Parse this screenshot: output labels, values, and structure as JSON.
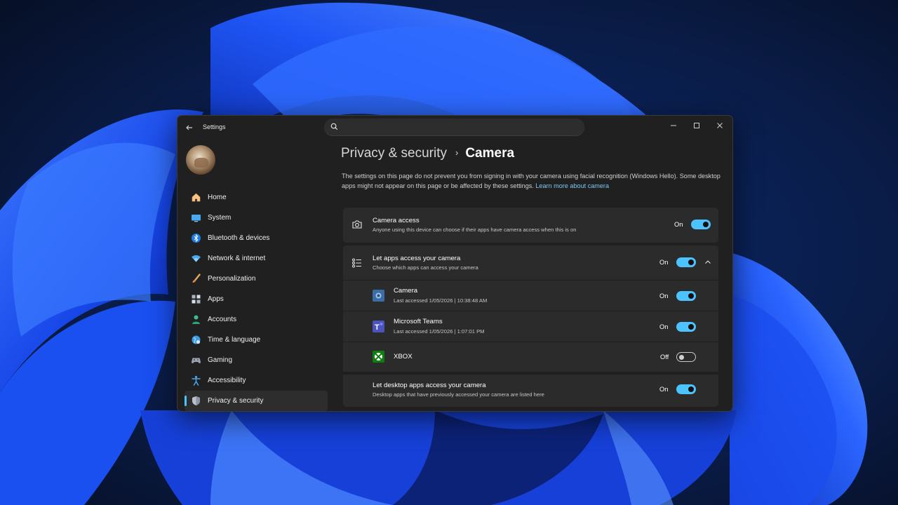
{
  "window": {
    "app_title": "Settings",
    "search_placeholder": ""
  },
  "sidebar": {
    "items": [
      {
        "label": "Home",
        "icon": "home-icon"
      },
      {
        "label": "System",
        "icon": "system-icon"
      },
      {
        "label": "Bluetooth & devices",
        "icon": "bluetooth-icon"
      },
      {
        "label": "Network & internet",
        "icon": "wifi-icon"
      },
      {
        "label": "Personalization",
        "icon": "brush-icon"
      },
      {
        "label": "Apps",
        "icon": "apps-icon"
      },
      {
        "label": "Accounts",
        "icon": "person-icon"
      },
      {
        "label": "Time & language",
        "icon": "globe-icon"
      },
      {
        "label": "Gaming",
        "icon": "gamepad-icon"
      },
      {
        "label": "Accessibility",
        "icon": "accessibility-icon"
      },
      {
        "label": "Privacy & security",
        "icon": "shield-icon",
        "active": true
      }
    ]
  },
  "header": {
    "parent": "Privacy & security",
    "separator": "›",
    "current": "Camera"
  },
  "description": {
    "text": "The settings on this page do not prevent you from signing in with your camera using facial recognition (Windows Hello). Some desktop apps might not appear on this page or be affected by these settings.",
    "link": "Learn more about camera"
  },
  "camera_access": {
    "title": "Camera access",
    "subtitle": "Anyone using this device can choose if their apps have camera access when this is on",
    "state": "On",
    "enabled": true
  },
  "let_apps": {
    "title": "Let apps access your camera",
    "subtitle": "Choose which apps can access your camera",
    "state": "On",
    "enabled": true,
    "expanded": true
  },
  "apps": [
    {
      "name": "Camera",
      "detail": "Last accessed 1/05/2026  |  10:38:48 AM",
      "state": "On",
      "enabled": true,
      "icon": "camera-app-icon"
    },
    {
      "name": "Microsoft Teams",
      "detail": "Last accessed 1/05/2026  |  1:07:01 PM",
      "state": "On",
      "enabled": true,
      "icon": "teams-icon"
    },
    {
      "name": "XBOX",
      "detail": "",
      "state": "Off",
      "enabled": false,
      "icon": "xbox-icon"
    }
  ],
  "desktop_apps": {
    "title": "Let desktop apps access your camera",
    "subtitle": "Desktop apps that have previously accessed your camera are listed here",
    "state": "On",
    "enabled": true
  },
  "colors": {
    "accent": "#4cc2ff",
    "window_bg": "#202020",
    "card_bg": "#2b2b2b",
    "wallpaper_dark": "#071633",
    "wallpaper_blue": "#1e50ff"
  }
}
